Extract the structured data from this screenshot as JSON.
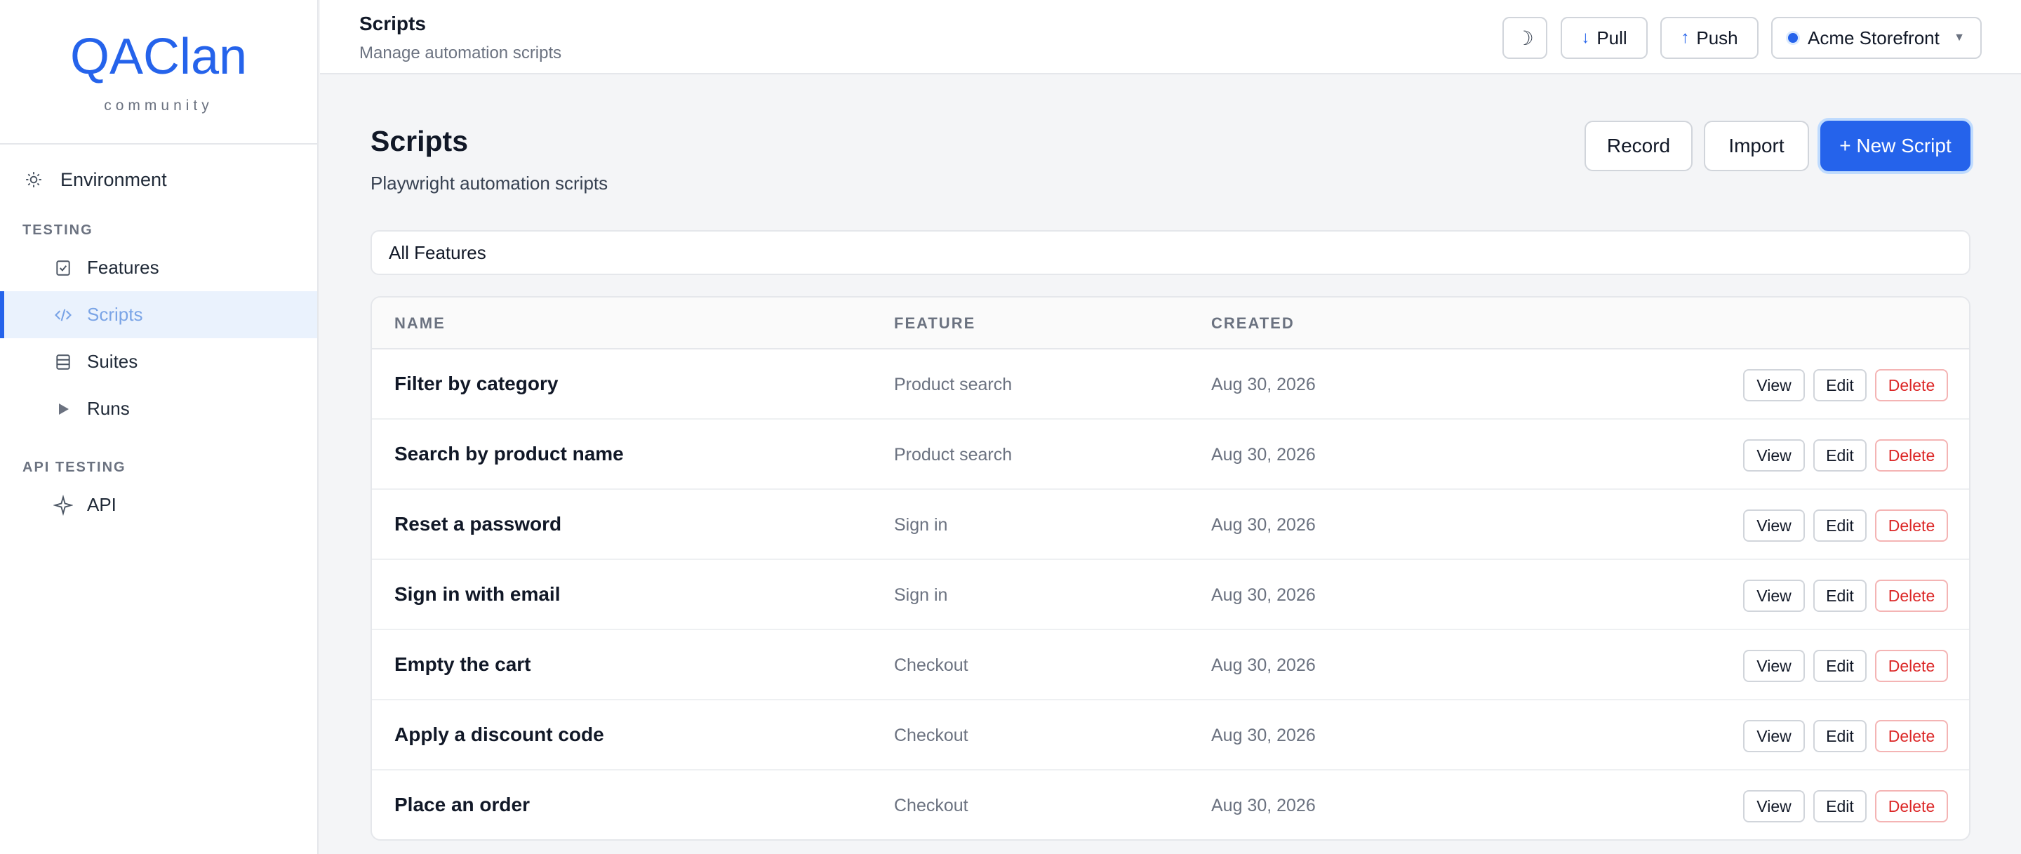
{
  "brand": {
    "logo_q": "Q",
    "logo_rest": "AClan",
    "sub": "community"
  },
  "sidebar": {
    "environment": "Environment",
    "sections": [
      {
        "label": "TESTING",
        "items": [
          "Features",
          "Scripts",
          "Suites",
          "Runs"
        ]
      },
      {
        "label": "API TESTING",
        "items": [
          "API"
        ]
      }
    ],
    "active_item": "Scripts"
  },
  "topbar": {
    "title": "Scripts",
    "subtitle": "Manage automation scripts",
    "theme_icon": "☽",
    "pull": "Pull",
    "push": "Push",
    "project": "Acme Storefront"
  },
  "main": {
    "title": "Scripts",
    "subtitle": "Playwright automation scripts",
    "actions": {
      "record": "Record",
      "import": "Import",
      "new_script": "+ New Script"
    },
    "filter": "All Features"
  },
  "table": {
    "columns": [
      "NAME",
      "FEATURE",
      "CREATED"
    ],
    "row_actions": {
      "view": "View",
      "edit": "Edit",
      "delete": "Delete"
    },
    "rows": [
      {
        "name": "Filter by category",
        "feature": "Product search",
        "created": "Aug 30, 2026"
      },
      {
        "name": "Search by product name",
        "feature": "Product search",
        "created": "Aug 30, 2026"
      },
      {
        "name": "Reset a password",
        "feature": "Sign in",
        "created": "Aug 30, 2026"
      },
      {
        "name": "Sign in with email",
        "feature": "Sign in",
        "created": "Aug 30, 2026"
      },
      {
        "name": "Empty the cart",
        "feature": "Checkout",
        "created": "Aug 30, 2026"
      },
      {
        "name": "Apply a discount code",
        "feature": "Checkout",
        "created": "Aug 30, 2026"
      },
      {
        "name": "Place an order",
        "feature": "Checkout",
        "created": "Aug 30, 2026"
      }
    ]
  },
  "colors": {
    "accent": "#2563eb",
    "danger": "#dc2626",
    "active_bg": "#eaf2fd"
  }
}
